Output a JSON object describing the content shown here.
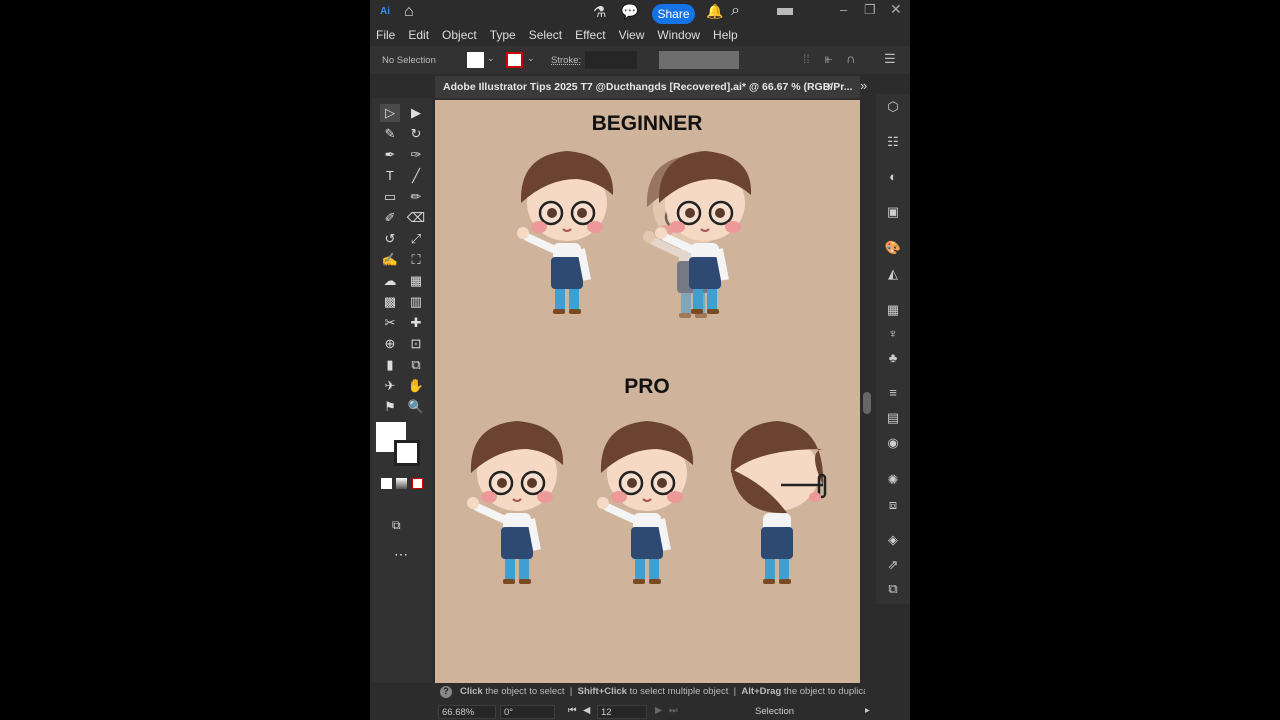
{
  "titlebar": {
    "app_icon": "Ai",
    "home_icon": "home-icon",
    "share_label": "Share",
    "icons": [
      "flask-icon",
      "comment-icon",
      "bell-icon",
      "search-icon",
      "workspace-icon"
    ],
    "window_controls": [
      "minimize-icon",
      "restore-icon",
      "close-icon"
    ]
  },
  "menu": [
    "File",
    "Edit",
    "Object",
    "Type",
    "Select",
    "Effect",
    "View",
    "Window",
    "Help"
  ],
  "control": {
    "selection_label": "No Selection",
    "stroke_label": "Stroke:"
  },
  "document_tab": {
    "title": "Adobe Illustrator Tips 2025 T7 @Ducthangds [Recovered].ai* @ 66.67 % (RGB/Pr...",
    "close": "×",
    "more": "»"
  },
  "artboard": {
    "heading_beginner": "BEGINNER",
    "heading_pro": "PRO",
    "background": "#cfb39b"
  },
  "tools": [
    "▷",
    "▶",
    "✎",
    "↻",
    "✒",
    "✑",
    "T",
    "╱",
    "▭",
    "✏",
    "✐",
    "⌫",
    "↺",
    "⤢",
    "✍",
    "⛶",
    "☁",
    "▦",
    "▩",
    "▥",
    "✂",
    "✚",
    "⊕",
    "⊡",
    "▮",
    "⧉",
    "✈",
    "✋",
    "⚑",
    "🔍"
  ],
  "status": {
    "hint_bold_1": "Click",
    "hint_1": " the object to select",
    "hint_bold_2": "Shift+Click",
    "hint_2": " to select multiple object",
    "hint_bold_3": "Alt+Drag",
    "hint_3": " the object to duplicate",
    "zoom": "66.68%",
    "rotation": "0°",
    "artboard_number": "12",
    "mode": "Selection"
  },
  "colors": {
    "accent": "#1473e6",
    "canvas": "#cfb39b",
    "hair": "#6b4330",
    "apron": "#2e4a72",
    "jeans": "#3f9fd0"
  }
}
